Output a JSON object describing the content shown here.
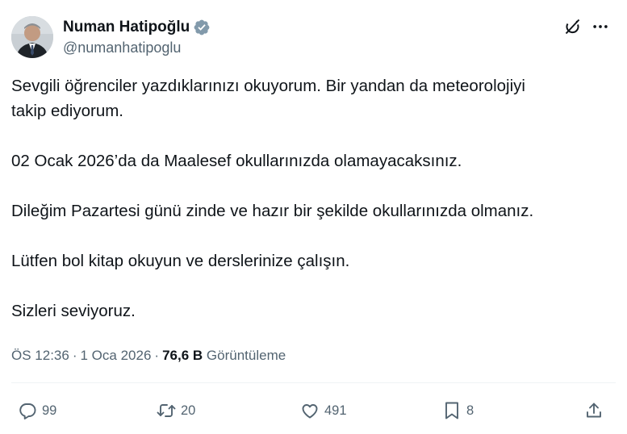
{
  "author": {
    "name": "Numan Hatipoğlu",
    "handle": "@numanhatipoglu",
    "verified": true,
    "avatar_icon": "profile-photo"
  },
  "tweet": {
    "paragraphs": [
      [
        "Sevgili öğrenciler yazdıklarınızı okuyorum. Bir yandan da meteorolojiyi",
        "takip ediyorum."
      ],
      [
        "02 Ocak 2026’da da Maalesef okullarınızda olamayacaksınız."
      ],
      [
        "Dileğim Pazartesi günü zinde ve hazır bir şekilde okullarınızda olmanız."
      ],
      [
        "Lütfen bol kitap okuyun ve derslerinize çalışın."
      ],
      [
        "Sizleri seviyoruz."
      ]
    ]
  },
  "meta": {
    "time": "ÖS 12:36",
    "separator": "·",
    "date": "1 Oca 2026",
    "views_count": "76,6 B",
    "views_label": "Görüntüleme"
  },
  "actions": {
    "reply_count": "99",
    "repost_count": "20",
    "like_count": "491",
    "bookmark_count": "8"
  },
  "icons": {
    "grok": "grok-icon",
    "more": "more-icon",
    "reply": "reply-icon",
    "repost": "repost-icon",
    "like": "heart-icon",
    "bookmark": "bookmark-icon",
    "share": "share-icon",
    "verified": "verified-badge-icon"
  },
  "colors": {
    "text": "#0f1419",
    "secondary": "#536471",
    "verified_badge": "#829aab"
  }
}
